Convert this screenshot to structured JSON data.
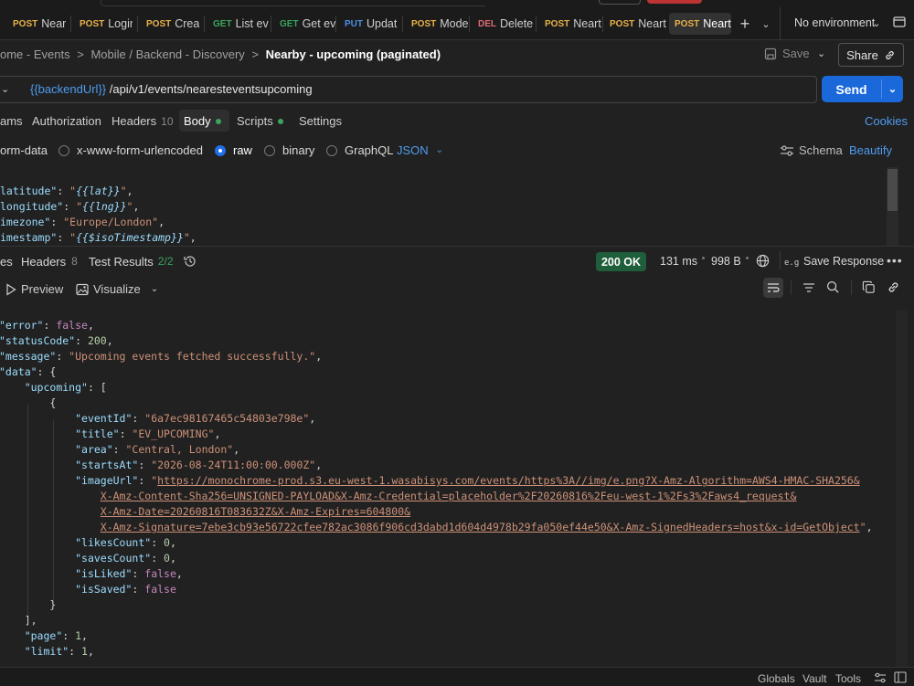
{
  "tabs": [
    {
      "method": "POST",
      "label": "Neart",
      "mcolor": "#e8b24a"
    },
    {
      "method": "POST",
      "label": "Login",
      "mcolor": "#e8b24a"
    },
    {
      "method": "POST",
      "label": "Creat",
      "mcolor": "#e8b24a"
    },
    {
      "method": "GET",
      "label": "List ev",
      "mcolor": "#3ba55d"
    },
    {
      "method": "GET",
      "label": "Get ev",
      "mcolor": "#3ba55d"
    },
    {
      "method": "PUT",
      "label": "Updat",
      "mcolor": "#4e8fe6"
    },
    {
      "method": "POST",
      "label": "Mode",
      "mcolor": "#e8b24a"
    },
    {
      "method": "DEL",
      "label": "Delete",
      "mcolor": "#e06c75"
    },
    {
      "method": "POST",
      "label": "Neart",
      "mcolor": "#e8b24a"
    },
    {
      "method": "POST",
      "label": "Neart",
      "mcolor": "#e8b24a"
    },
    {
      "method": "POST",
      "label": "Neart",
      "mcolor": "#e8b24a"
    }
  ],
  "environment": "No environment",
  "breadcrumb": {
    "items": [
      "ome - Events",
      "Mobile / Backend - Discovery"
    ],
    "current": "Nearby - upcoming (paginated)"
  },
  "save_label": "Save",
  "share_label": "Share",
  "url": {
    "var": "{{backendUrl}}",
    "path": " /api/v1/events/nearesteventsupcoming"
  },
  "send_label": "Send",
  "request_tabs": {
    "params": "ams",
    "authorization": "Authorization",
    "headers": "Headers",
    "headers_count": "10",
    "body": "Body",
    "scripts": "Scripts",
    "settings": "Settings",
    "cookies": "Cookies"
  },
  "body_types": {
    "form_data": "orm-data",
    "urlencoded": "x-www-form-urlencoded",
    "raw": "raw",
    "binary": "binary",
    "graphql": "GraphQL",
    "format": "JSON",
    "schema": "Schema",
    "beautify": "Beautify"
  },
  "response": {
    "tabs": {
      "body": "es",
      "headers": "Headers",
      "headers_count": "8",
      "tests": "Test Results",
      "tests_count": "2/2"
    },
    "status": "200 OK",
    "time": "131 ms",
    "size": "998 B",
    "save_response": "Save Response",
    "view": {
      "preview": "Preview",
      "visualize": "Visualize"
    }
  },
  "footer": {
    "globals": "Globals",
    "vault": "Vault",
    "tools": "Tools"
  },
  "colors": {
    "accent": "#1a68d9",
    "ok": "#1f5e3a",
    "post": "#e8b24a",
    "get": "#3ba55d"
  }
}
